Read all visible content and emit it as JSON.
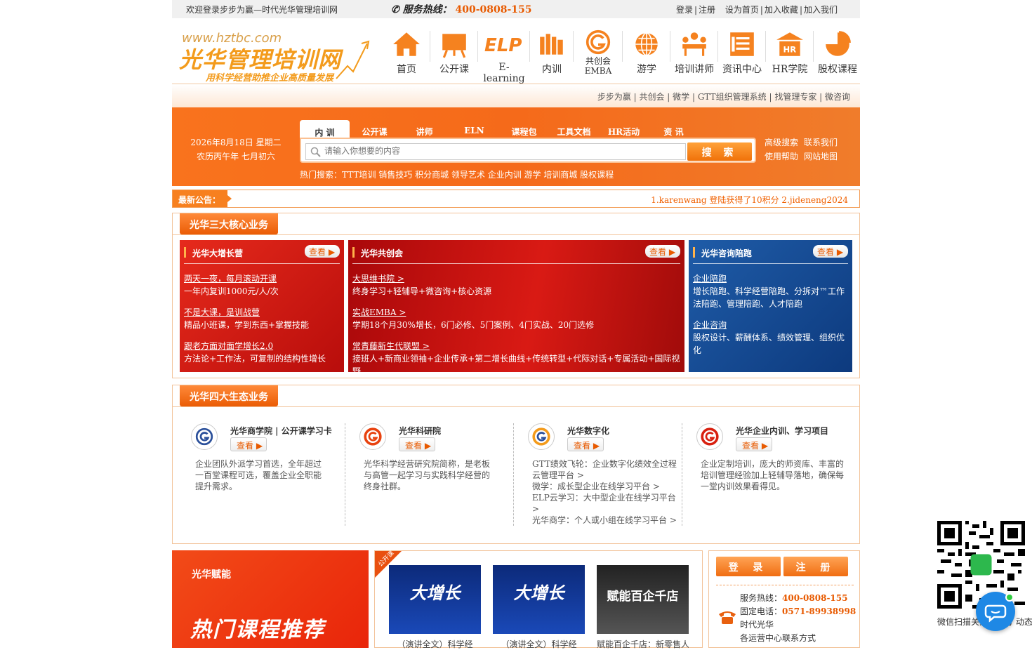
{
  "topbar": {
    "welcome": "欢迎登录步步为赢—时代光华管理培训网",
    "hotline_label": "服务热线：",
    "hotline_number": "400-0808-155",
    "links": [
      "登录",
      "注册",
      "设为首页",
      "加入收藏",
      "加入我们"
    ]
  },
  "logo": {
    "url": "www.hztbc.com",
    "name": "光华管理培训网",
    "slogan": "用科学经营助推企业高质量发展"
  },
  "nav": [
    {
      "label": "首页",
      "icon": "home-icon"
    },
    {
      "label": "公开课",
      "icon": "easel-icon"
    },
    {
      "label": "E-learning",
      "icon": "elp-icon"
    },
    {
      "label": "内训",
      "icon": "books-icon"
    },
    {
      "label": "共创会",
      "label2": "EMBA",
      "icon": "g-logo-icon"
    },
    {
      "label": "游学",
      "icon": "globe-icon"
    },
    {
      "label": "培训讲师",
      "icon": "lecturer-icon"
    },
    {
      "label": "资讯中心",
      "icon": "news-icon"
    },
    {
      "label": "HR学院",
      "icon": "hr-building-icon"
    },
    {
      "label": "股权课程",
      "icon": "pie-icon"
    }
  ],
  "subbar": {
    "links": "步步为赢 | 共创会 | 微学 | GTT组织管理系统 | 找管理专家 | 微咨询"
  },
  "search": {
    "date_line1": "2026年8月18日 星期二",
    "date_line2": "农历丙午年 七月初六",
    "tabs": [
      "内 训",
      "公开课",
      "讲师",
      "ELN",
      "课程包",
      "工具文档",
      "HR活动",
      "资 讯"
    ],
    "placeholder": "请输入你想要的内容",
    "button": "搜 索",
    "side_links": [
      "高级搜索",
      "联系我们",
      "使用帮助",
      "网站地图"
    ],
    "hot_label": "热门搜索：",
    "hot_terms": "TTT培训 销售技巧 积分商城 领导艺术 企业内训 游学 培训商城 股权课程"
  },
  "notice": {
    "label": "最新公告：",
    "message": "1.karenwang 登陆获得了10积分  2.jideneng2024"
  },
  "core": {
    "title": "光华三大核心业务",
    "more": "查看",
    "cards": [
      {
        "title": "光华大增长营",
        "items": [
          {
            "link": "两天一夜，每月滚动开课",
            "desc": "一年内复训1000元/人/次"
          },
          {
            "link": "不是大课，是训战营",
            "desc": "精品小班课，学到东西+掌握技能"
          },
          {
            "link": "跟老方面对面学增长2.0",
            "desc": "方法论+工作法，可复制的结构性增长"
          }
        ]
      },
      {
        "title": "光华共创会",
        "items": [
          {
            "link": "大思维书院 >",
            "desc": "终身学习+轻辅导+微咨询+核心资源"
          },
          {
            "link": "实战EMBA >",
            "desc": "学期18个月30%增长，6门必修、5门案例、4门实战、20门选修"
          },
          {
            "link": "常青藤新生代联盟 >",
            "desc": "接班人+新商业领袖+企业传承+第二增长曲线+传统转型+代际对话+专属活动+国际视野"
          }
        ]
      },
      {
        "title": "光华咨询陪跑",
        "items": [
          {
            "link": "企业陪跑",
            "desc": "增长陪跑、科学经营陪跑、分拆对™工作法陪跑、管理陪跑、人才陪跑"
          },
          {
            "link": "企业咨询",
            "desc": "股权设计、薪酬体系、绩效管理、组织优化"
          }
        ]
      }
    ]
  },
  "eco": {
    "title": "光华四大生态业务",
    "more": "查看",
    "items": [
      {
        "name": "光华商学院 | 公开课学习卡",
        "desc": "企业团队外派学习首选，全年超过一百堂课程可选，覆盖企业全职能提升需求。"
      },
      {
        "name": "光华科研院",
        "desc": "光华科学经营研究院简称，是老板与高管一起学习与实践科学经营的终身社群。"
      },
      {
        "name": "光华数字化",
        "desc": "GTT绩效飞轮：企业数字化绩效全过程云管理平台 >\n微学：成长型企业在线学习平台 >\nELP云学习：大中型企业在线学习平台 >\n光华商学：个人或小组在线学习平台 >"
      },
      {
        "name": "光华企业内训、学习项目",
        "desc": "企业定制培训，庞大的师资库、丰富的培训管理经验加上轻辅导落地，确保每一堂内训效果看得见。"
      }
    ]
  },
  "bottom": {
    "promo_brand": "光华赋能",
    "promo_title": "热门课程推荐",
    "ribbon": "公开课",
    "courses": [
      {
        "pic": "大增长",
        "caption": "（演讲全文）科学经"
      },
      {
        "pic": "大增长",
        "caption": "（演讲全文）科学经"
      },
      {
        "pic": "赋能百企千店",
        "caption": "赋能百企千店：新零售人"
      }
    ],
    "login": "登 录",
    "register": "注 册",
    "hotline_label": "服务热线：",
    "hotline": "400-0808-155",
    "fixed_label": "固定电话：",
    "fixed": "0571-89938998",
    "company": "时代光华",
    "branch": "各运营中心联系方式"
  },
  "qr_caption": "微信扫描关注公众号 动态",
  "colors": {
    "brand_orange": "#f7801f",
    "red": "#d91a14",
    "blue": "#1f5ca8"
  }
}
